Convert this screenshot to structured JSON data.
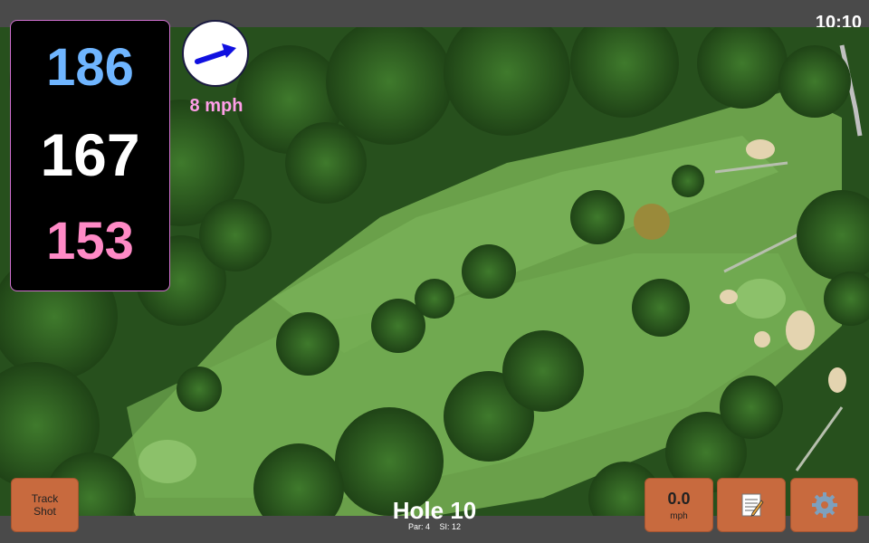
{
  "clock": "10:10",
  "distances": {
    "back": "186",
    "middle": "167",
    "front": "153",
    "back_color": "#6fb5ff",
    "middle_color": "#ffffff",
    "front_color": "#ff8ac6"
  },
  "wind": {
    "speed": "8 mph",
    "arrow_color": "#1010e0",
    "label_color": "#ff9ee8"
  },
  "buttons": {
    "track_shot": "Track Shot",
    "speed_value": "0.0",
    "speed_unit": "mph",
    "notes_icon": "memo-icon",
    "settings_icon": "gear-icon"
  },
  "hole": {
    "title": "Hole 10",
    "par": "Par: 4",
    "si": "SI: 12"
  },
  "colors": {
    "accent_button": "#c86a3e",
    "bar": "#4a4a4a"
  }
}
